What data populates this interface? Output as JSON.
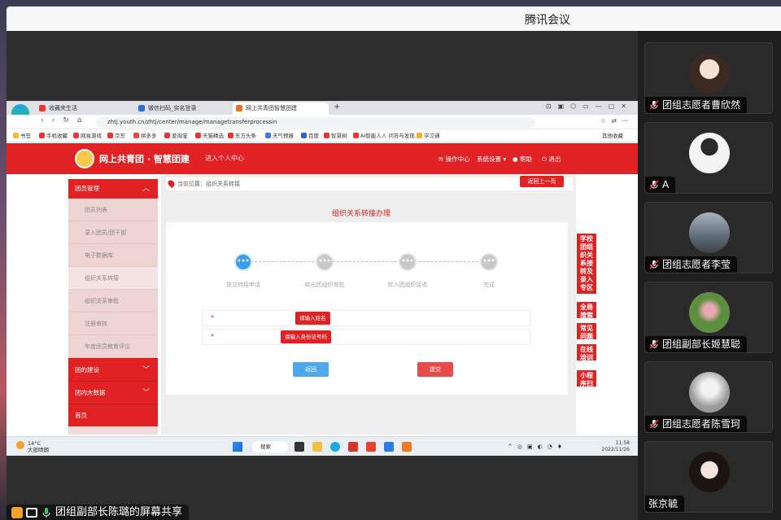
{
  "app": {
    "title": "腾讯会议",
    "share_label": "团组副部长陈璐的屏幕共享"
  },
  "participants": [
    {
      "name": "团组志愿者曹欣然",
      "avatar_color": "#d8c2b2"
    },
    {
      "name": "A",
      "avatar_color": "#f3f3f3"
    },
    {
      "name": "团组志愿者李莹",
      "avatar_color": "#7f8d9a"
    },
    {
      "name": "团组副部长姬慧聪",
      "avatar_color": "#6a9a4a"
    },
    {
      "name": "团组志愿者陈雪珂",
      "avatar_color": "#c9c9c9"
    },
    {
      "name": "张京毓",
      "avatar_color": "#e9e2dd"
    }
  ],
  "browser": {
    "tabs": [
      "收藏夹生活",
      "微信扫码_实名登录",
      "网上共青团智慧团建"
    ],
    "url": "zhtj.youth.cn/zhtj/center/manage/managetransferprocessin",
    "bookmarks": [
      "书签",
      "手机收藏",
      "网易游戏",
      "京东",
      "拼多多",
      "爱淘宝",
      "天猫精选",
      "东方头条",
      "天气预报",
      "百度",
      "智慧树",
      "AI智能人人 问答与发现...",
      "学习通"
    ],
    "right_bookmark": "其他收藏"
  },
  "site": {
    "title": "网上共青团 · 智慧团建",
    "subtitle": "进入个人中心",
    "nav": [
      "操作中心",
      "系统设置",
      "帮助",
      "退出"
    ]
  },
  "sidebar": {
    "top": "团员管理",
    "items": [
      "团员列表",
      "录入团员/团干部",
      "电子数据库",
      "组织关系转接",
      "组织关系审批",
      "注册审核",
      "年度团员教育评议"
    ],
    "sections": [
      "团的建设",
      "团内大数据",
      "首页"
    ]
  },
  "main": {
    "breadcrumb": "当前位置：组织关系转接",
    "back_top": "返回上一页",
    "title": "组织关系转接办理",
    "steps": [
      "提交转接申请",
      "转出团组织审批",
      "转入团组织接收",
      "完成"
    ],
    "step_glyph": "•••",
    "fields": [
      {
        "star": "*",
        "tip": "请输入姓名"
      },
      {
        "star": "*",
        "tip": "请输入身份证号码"
      }
    ],
    "back_button": "返回",
    "submit_button": "提交"
  },
  "floats": [
    "学校团组织关系接转及录入专区",
    "全局搜索",
    "常见问题",
    "在线培训",
    "小程序扫一扫"
  ],
  "taskbar": {
    "weather_temp": "14°C",
    "weather_desc": "大部晴朗",
    "search": "搜索",
    "time": "11:58",
    "date": "2022/11/26"
  }
}
